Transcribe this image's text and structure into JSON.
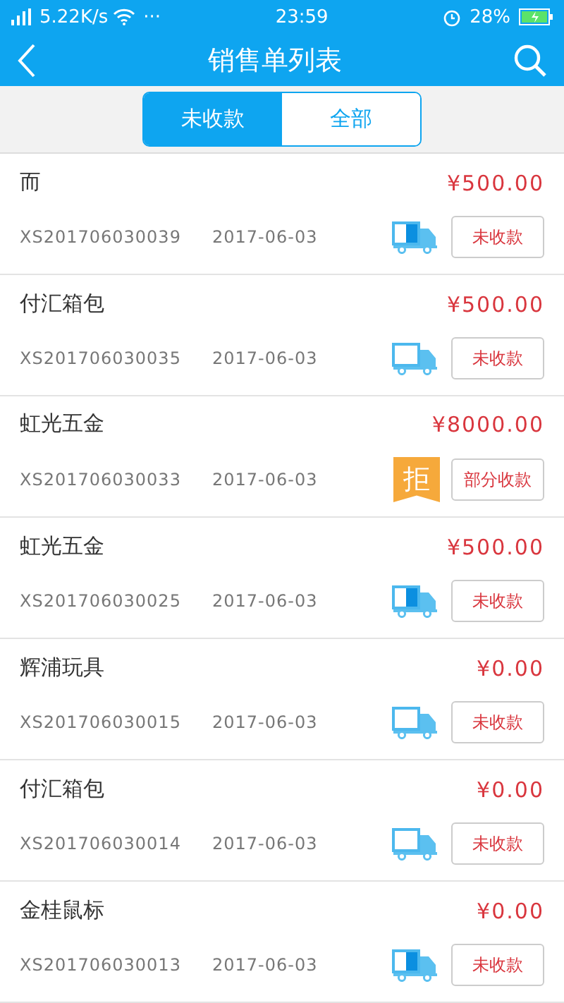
{
  "status_bar": {
    "network": "5.22K/s",
    "dots": "···",
    "time": "23:59",
    "battery": "28%"
  },
  "header": {
    "title": "销售单列表"
  },
  "tabs": [
    {
      "label": "未收款",
      "selected": true
    },
    {
      "label": "全部",
      "selected": false
    }
  ],
  "orders": [
    {
      "customer": "而",
      "order_no": "XS201706030039",
      "date": "2017-06-03",
      "amount": "¥500.00",
      "status_icon": {
        "kind": "partial"
      },
      "status": "未收款"
    },
    {
      "customer": "付汇箱包",
      "order_no": "XS201706030035",
      "date": "2017-06-03",
      "amount": "¥500.00",
      "status_icon": {
        "kind": "empty"
      },
      "status": "未收款"
    },
    {
      "customer": "虹光五金",
      "order_no": "XS201706030033",
      "date": "2017-06-03",
      "amount": "¥8000.00",
      "status_icon": {
        "kind": "rejected",
        "label": "拒"
      },
      "status": "部分收款"
    },
    {
      "customer": "虹光五金",
      "order_no": "XS201706030025",
      "date": "2017-06-03",
      "amount": "¥500.00",
      "status_icon": {
        "kind": "partial"
      },
      "status": "未收款"
    },
    {
      "customer": "辉浦玩具",
      "order_no": "XS201706030015",
      "date": "2017-06-03",
      "amount": "¥0.00",
      "status_icon": {
        "kind": "empty"
      },
      "status": "未收款"
    },
    {
      "customer": "付汇箱包",
      "order_no": "XS201706030014",
      "date": "2017-06-03",
      "amount": "¥0.00",
      "status_icon": {
        "kind": "empty"
      },
      "status": "未收款"
    },
    {
      "customer": "金桂鼠标",
      "order_no": "XS201706030013",
      "date": "2017-06-03",
      "amount": "¥0.00",
      "status_icon": {
        "kind": "partial"
      },
      "status": "未收款"
    }
  ]
}
